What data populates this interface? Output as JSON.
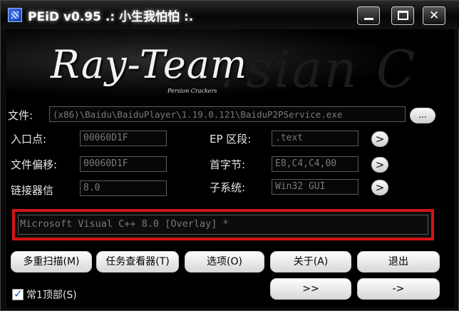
{
  "titlebar": {
    "title": "PEiD v0.95 .: 小生我怕怕 :.",
    "icon": "peid-app-icon",
    "minimize_icon": "minimize-icon",
    "maximize_icon": "maximize-icon",
    "close_label": "✕"
  },
  "banner": {
    "logo": "Ray-Team",
    "subtitle": "Persion Crackers",
    "bg_text": "rsian C"
  },
  "file": {
    "label": "文件:",
    "value": "(x86)\\Baidu\\BaiduPlayer\\1.19.0.121\\BaiduP2PService.exe",
    "browse_label": "..."
  },
  "fields": {
    "entry_point": {
      "label": "入口点:",
      "value": "00060D1F"
    },
    "file_offset": {
      "label": "文件偏移:",
      "value": "00060D1F"
    },
    "linker_info": {
      "label": "链接器信",
      "value": "8.0"
    },
    "ep_section": {
      "label": "EP 区段:",
      "value": ".text"
    },
    "first_bytes": {
      "label": "首字节:",
      "value": "E8,C4,C4,00"
    },
    "subsystem": {
      "label": "子系统:",
      "value": "Win32 GUI"
    },
    "arrow_label": ">"
  },
  "signature": {
    "value": "Microsoft Visual C++ 8.0 [Overlay] *",
    "highlight_color": "#d41414"
  },
  "buttons": {
    "multi_scan": "多重扫描(M)",
    "task_viewer": "任务查看器(T)",
    "options": "选项(O)",
    "about": "关于(A)",
    "exit": "退出",
    "ext_plugins": ">>",
    "plugins": "->"
  },
  "stay_on_top": {
    "label": "常1顶部(S)",
    "checked": true
  }
}
